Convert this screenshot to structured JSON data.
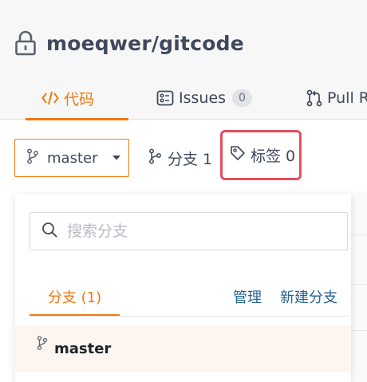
{
  "repo": {
    "name": "moeqwer/gitcode",
    "lock_icon": "lock-icon"
  },
  "tabs": [
    {
      "label": "代码",
      "icon": "code-icon",
      "active": true
    },
    {
      "label": "Issues",
      "icon": "issues-icon",
      "count": "0"
    },
    {
      "label": "Pull R",
      "icon": "pull-request-icon"
    }
  ],
  "toolbar": {
    "branch_select": {
      "value": "master",
      "icon": "branch-icon",
      "caret": "caret-down-icon"
    },
    "branches_link": {
      "label": "分支 1",
      "icon": "branch-icon"
    },
    "tags_link": {
      "label": "标签 0",
      "icon": "tag-icon"
    }
  },
  "dropdown": {
    "search": {
      "placeholder": "搜索分支",
      "value": "",
      "icon": "search-icon"
    },
    "tab_label": "分支 (1)",
    "manage_label": "管理",
    "new_branch_label": "新建分支",
    "items": [
      {
        "name": "master",
        "icon": "branch-icon"
      }
    ]
  },
  "colors": {
    "accent": "#f0790f",
    "highlight_border": "#e34f5e",
    "link": "#246494",
    "text": "#40485b"
  }
}
